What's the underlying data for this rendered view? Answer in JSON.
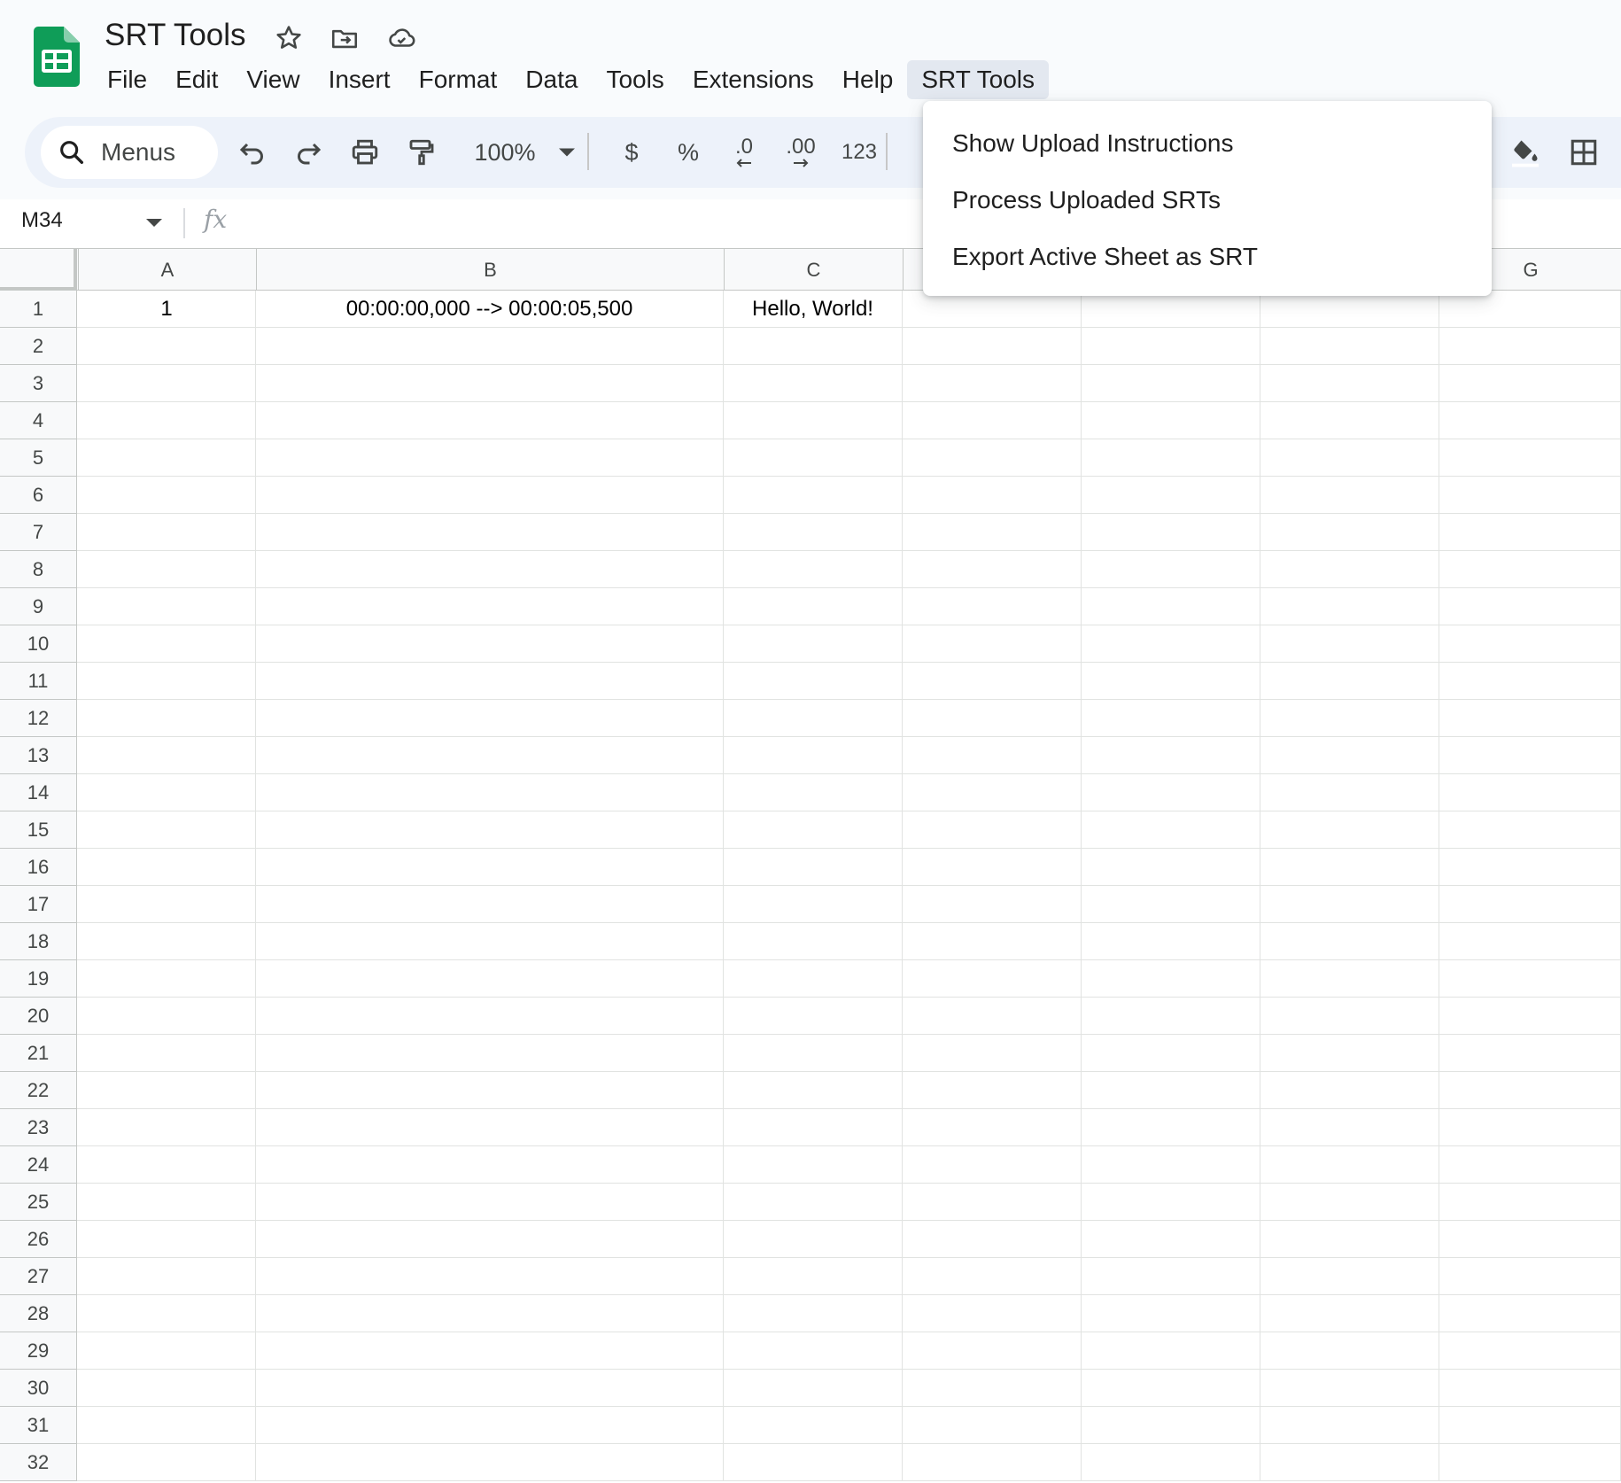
{
  "app": {
    "doc_title": "SRT Tools",
    "brand_color": "#0f9d58"
  },
  "title_icons": [
    "star-icon",
    "move-to-folder-icon",
    "cloud-saved-icon"
  ],
  "menubar": {
    "items": [
      "File",
      "Edit",
      "View",
      "Insert",
      "Format",
      "Data",
      "Tools",
      "Extensions",
      "Help",
      "SRT Tools"
    ],
    "active_item": "SRT Tools"
  },
  "toolbar": {
    "search_label": "Menus",
    "zoom": "100%",
    "currency": "$",
    "percent": "%",
    "decrease_decimal": ".0",
    "increase_decimal": ".00",
    "number_format": "123",
    "icons": [
      "search-icon",
      "undo-icon",
      "redo-icon",
      "print-icon",
      "paint-format-icon",
      "zoom-dropdown-icon",
      "fill-color-icon",
      "borders-icon"
    ]
  },
  "formula_bar": {
    "name_box": "M34",
    "fx_label": "fx",
    "formula": ""
  },
  "grid": {
    "columns": [
      "A",
      "B",
      "C",
      "",
      "",
      "",
      "G"
    ],
    "row_count": 32,
    "cells": {
      "1": [
        "1",
        "00:00:00,000 --> 00:00:05,500",
        "Hello, World!",
        "",
        "",
        "",
        ""
      ]
    }
  },
  "dropdown_menu": {
    "parent": "SRT Tools",
    "items": [
      "Show Upload Instructions",
      "Process Uploaded SRTs",
      "Export Active Sheet as SRT"
    ]
  },
  "colors": {
    "header_bg": "#f9fbfd",
    "toolbar_bg": "#edf2fa",
    "active_menu_bg": "#e3e8f0",
    "gridline": "#e1e3e1",
    "header_border": "#c4c7c5"
  }
}
